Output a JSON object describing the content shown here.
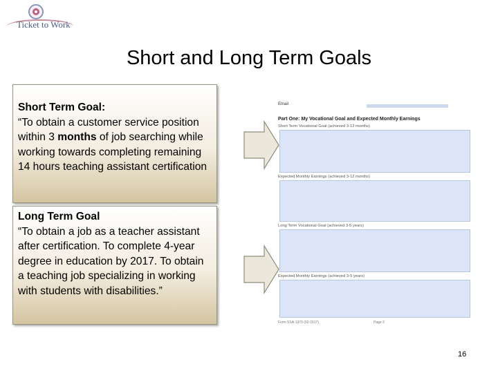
{
  "logo": {
    "text": "Ticket to Work"
  },
  "title": "Short and Long Term Goals",
  "short_goal": {
    "heading": "Short Term Goal:",
    "text_before": "“To obtain a customer service position within 3 ",
    "text_bold": "months",
    "text_after": " of job searching while working towards completing remaining 14 hours teaching assistant certification"
  },
  "long_goal": {
    "heading": "Long Term Goal",
    "text": "“To obtain a job as a teacher assistant after certification. To complete 4-year degree in education by 2017. To obtain a teaching job specializing in working with students with disabilities.”"
  },
  "form": {
    "email_label": "Email",
    "part_title": "Part One:  My Vocational Goal and Expected Monthly Earnings",
    "short_goal_label": "Short Term Vocational Goal (achieved 3-12 months)",
    "short_earnings_label": "Expected Monthly Earnings (achieved 3-12 months)",
    "long_goal_label": "Long Term Vocational Goal (achieved 3-5 years)",
    "long_earnings_label": "Expected Monthly Earnings (achieved 3-5 years)",
    "footer_left": "Form SSA-1370 (02-2017)",
    "footer_right": "Page 2"
  },
  "page_number": "16",
  "colors": {
    "form_field": "#dbe5f7",
    "box_gradient_end": "#d4c5a1"
  }
}
